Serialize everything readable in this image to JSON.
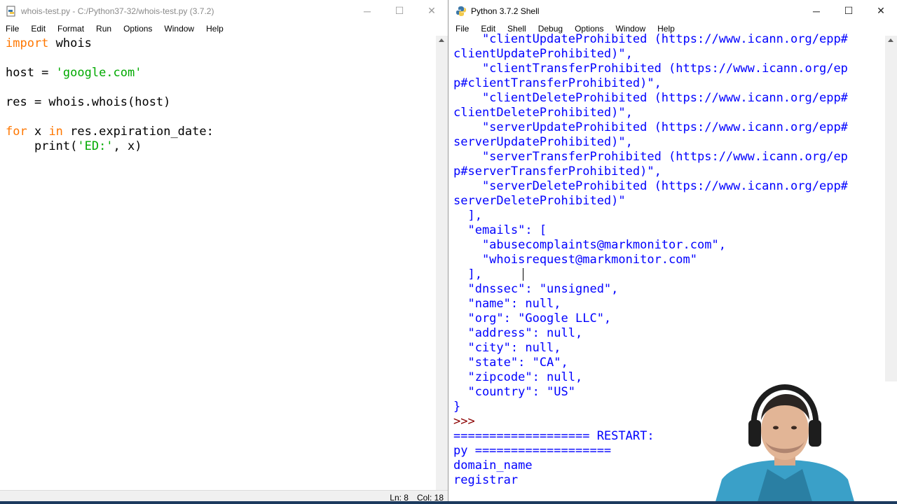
{
  "editor": {
    "title": "whois-test.py - C:/Python37-32/whois-test.py (3.7.2)",
    "menu": [
      "File",
      "Edit",
      "Format",
      "Run",
      "Options",
      "Window",
      "Help"
    ],
    "status": {
      "line": "Ln: 8",
      "col": "Col: 18"
    }
  },
  "shell": {
    "title": "Python 3.7.2 Shell",
    "menu": [
      "File",
      "Edit",
      "Shell",
      "Debug",
      "Options",
      "Window",
      "Help"
    ]
  },
  "window_controls": {
    "minimize": "─",
    "maximize": "☐",
    "close": "✕"
  },
  "colors": {
    "keyword": "#ff7700",
    "string": "#00aa00",
    "output": "#0000ff",
    "stdout": "#00008b",
    "prompt": "#8b0000"
  }
}
